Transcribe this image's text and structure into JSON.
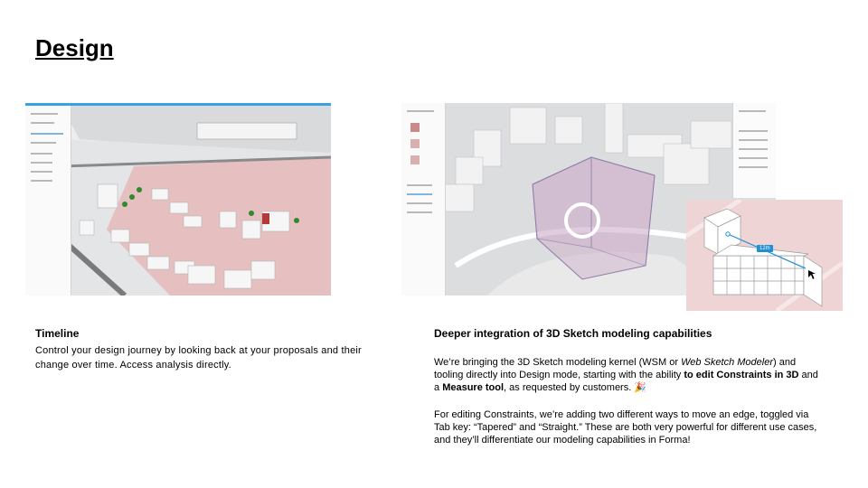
{
  "slide": {
    "title": "Design"
  },
  "left": {
    "heading": "Timeline",
    "body": "Control your design journey by looking back at your proposals and their change over time. Access analysis directly."
  },
  "right": {
    "heading": "Deeper integration of 3D Sketch modeling capabilities",
    "p1": {
      "t1": "We’re bringing the 3D Sketch modeling kernel (WSM or ",
      "t2": "Web Sketch Modeler",
      "t3": ") and tooling directly into Design mode, starting with the ability ",
      "t4": "to edit Constraints in 3D",
      "t5": " and a ",
      "t6": "Measure tool",
      "t7": ",  as requested by customers. ",
      "emoji": "🎉"
    },
    "p2": "For editing Constraints, we’re adding two different ways to move an edge, toggled via Tab key:   “Tapered” and “Straight.” These are both very powerful for different use cases, and they’ll differentiate our modeling capabilities in Forma!"
  },
  "inset": {
    "measure_label": "12m"
  },
  "colors": {
    "site_pink": "#e6b8b8",
    "accent_blue": "#1f8fd6"
  }
}
